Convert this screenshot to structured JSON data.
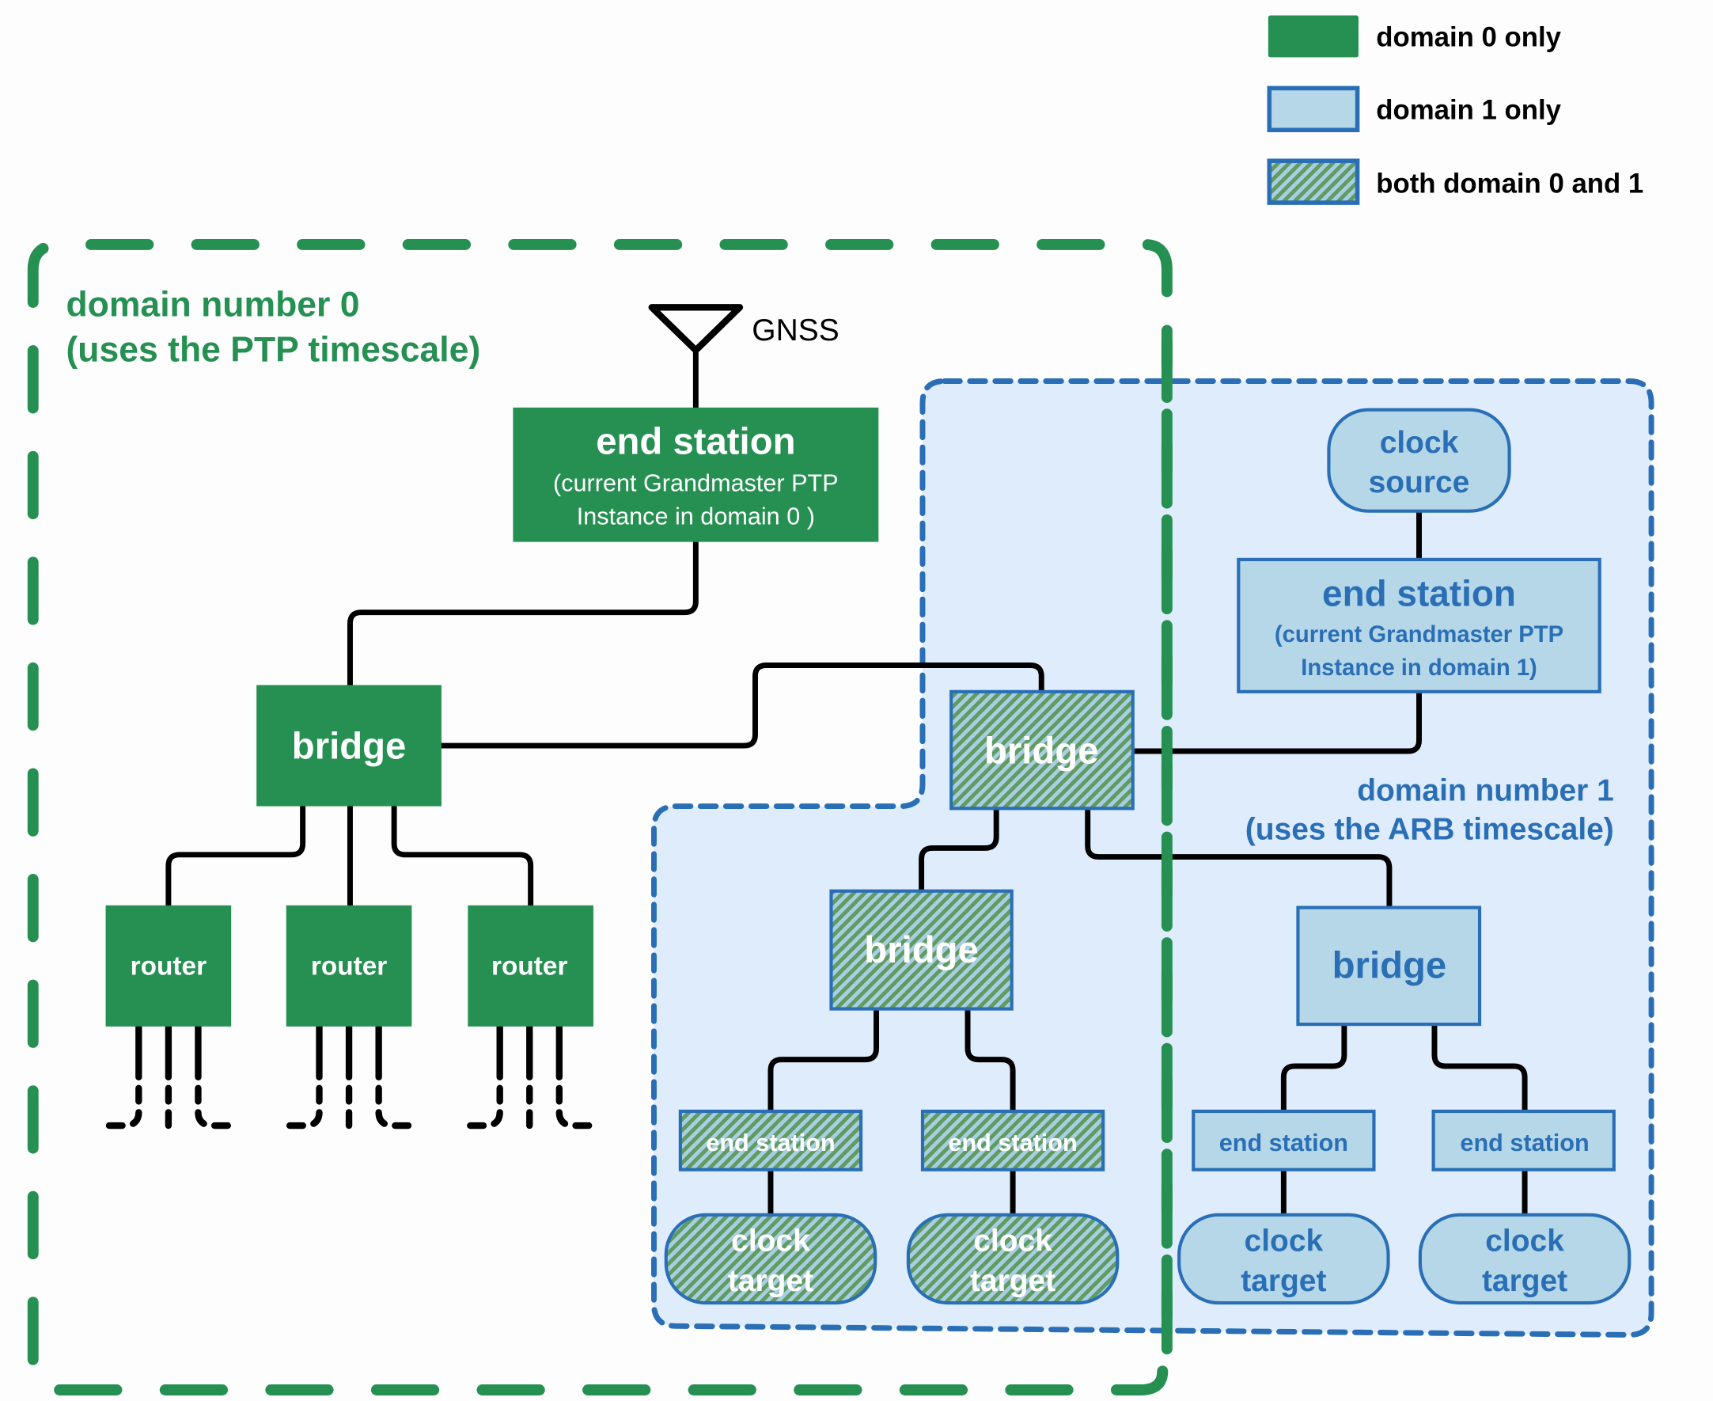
{
  "colors": {
    "domain0": "#259052",
    "domain1_fill": "#b5d7e8",
    "domain1_stroke": "#2a6fb6",
    "region1_bg": "#deecfb",
    "label_green": "#259052",
    "label_blue": "#2a6fb6"
  },
  "legend": {
    "items": [
      {
        "label": "domain 0 only",
        "style": "domain0"
      },
      {
        "label": "domain 1 only",
        "style": "domain1"
      },
      {
        "label": "both domain 0 and 1",
        "style": "both"
      }
    ]
  },
  "domain0": {
    "title_line1": "domain number 0",
    "title_line2": "(uses the PTP timescale)"
  },
  "domain1": {
    "title_line1": "domain number 1",
    "title_line2": "(uses the ARB timescale)"
  },
  "gnss": {
    "label": "GNSS"
  },
  "nodes": {
    "gm0": {
      "title": "end station",
      "line1": "(current Grandmaster PTP",
      "line2": "Instance in domain 0 )"
    },
    "bridge_d0": {
      "label": "bridge"
    },
    "routers": [
      {
        "label": "router"
      },
      {
        "label": "router"
      },
      {
        "label": "router"
      }
    ],
    "clock_source": {
      "line1": "clock",
      "line2": "source"
    },
    "gm1": {
      "title": "end station",
      "line1": "(current Grandmaster PTP",
      "line2": "Instance in domain 1)"
    },
    "bridge_both_top": {
      "label": "bridge"
    },
    "bridge_both_mid": {
      "label": "bridge"
    },
    "bridge_d1": {
      "label": "bridge"
    },
    "end_stations": [
      {
        "label": "end station"
      },
      {
        "label": "end station"
      },
      {
        "label": "end station"
      },
      {
        "label": "end station"
      }
    ],
    "clock_targets": [
      {
        "line1": "clock",
        "line2": "target"
      },
      {
        "line1": "clock",
        "line2": "target"
      },
      {
        "line1": "clock",
        "line2": "target"
      },
      {
        "line1": "clock",
        "line2": "target"
      }
    ]
  }
}
